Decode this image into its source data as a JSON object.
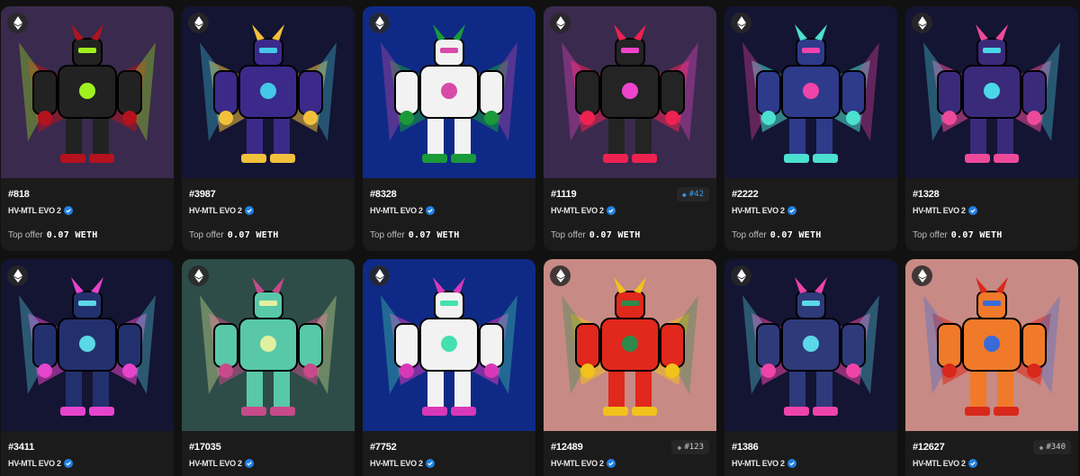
{
  "collection_name": "HV-MTL EVO 2",
  "offer_label": "Top offer",
  "offer_value": "0.07 WETH",
  "colors": {
    "page_bg": "#111111",
    "card_bg": "#1b1b1b",
    "verified_blue": "#2081e2",
    "rank_blue": "#3c9ae8"
  },
  "cards": [
    {
      "id": "#818",
      "bg": "#3a2a4e",
      "mech": [
        "#222222",
        "#b3121e",
        "#a0f020"
      ],
      "chain_icon": "ethereum-icon",
      "show_offer": true
    },
    {
      "id": "#3987",
      "bg": "#141433",
      "mech": [
        "#3b2a8a",
        "#f2c13c",
        "#44c8e8"
      ],
      "chain_icon": "ethereum-icon",
      "show_offer": true
    },
    {
      "id": "#8328",
      "bg": "#0f2a86",
      "mech": [
        "#f2f2f2",
        "#1a9a3a",
        "#d84aa8"
      ],
      "chain_icon": "ethereum-icon",
      "show_offer": true
    },
    {
      "id": "#1119",
      "bg": "#3a2a4e",
      "mech": [
        "#242424",
        "#ee2250",
        "#ee44cc"
      ],
      "chain_icon": "ethereum-icon",
      "show_offer": true,
      "rank": "#42",
      "rank_style": "blue"
    },
    {
      "id": "#2222",
      "bg": "#141433",
      "mech": [
        "#2e3a8a",
        "#4be0d0",
        "#f044aa"
      ],
      "chain_icon": "ethereum-icon",
      "show_offer": true
    },
    {
      "id": "#1328",
      "bg": "#141433",
      "mech": [
        "#3a2a7a",
        "#ee4a9a",
        "#4ad8e8"
      ],
      "chain_icon": "ethereum-icon",
      "show_offer": true
    },
    {
      "id": "#3411",
      "bg": "#141433",
      "mech": [
        "#23306e",
        "#e644cc",
        "#5ad8e8"
      ],
      "chain_icon": "ethereum-icon",
      "show_offer": false
    },
    {
      "id": "#17035",
      "bg": "#2e4d48",
      "mech": [
        "#58c8a8",
        "#c84a8a",
        "#e0f0a0"
      ],
      "chain_icon": "ethereum-icon",
      "show_offer": false
    },
    {
      "id": "#7752",
      "bg": "#0f2a86",
      "mech": [
        "#f2f2f2",
        "#d838b8",
        "#44e0b0"
      ],
      "chain_icon": "ethereum-icon",
      "show_offer": false
    },
    {
      "id": "#12489",
      "bg": "#c88a84",
      "mech": [
        "#e0281c",
        "#f2c21c",
        "#2e8a4a"
      ],
      "chain_icon": "ethereum-icon",
      "show_offer": false,
      "rank": "#123",
      "rank_style": "grey"
    },
    {
      "id": "#1386",
      "bg": "#141433",
      "mech": [
        "#2e3a7a",
        "#ee44aa",
        "#5ad8e8"
      ],
      "chain_icon": "ethereum-icon",
      "show_offer": false
    },
    {
      "id": "#12627",
      "bg": "#c88a84",
      "mech": [
        "#f07a2a",
        "#d8281c",
        "#3a6ad8"
      ],
      "chain_icon": "ethereum-icon",
      "show_offer": false,
      "rank": "#340",
      "rank_style": "grey"
    }
  ]
}
